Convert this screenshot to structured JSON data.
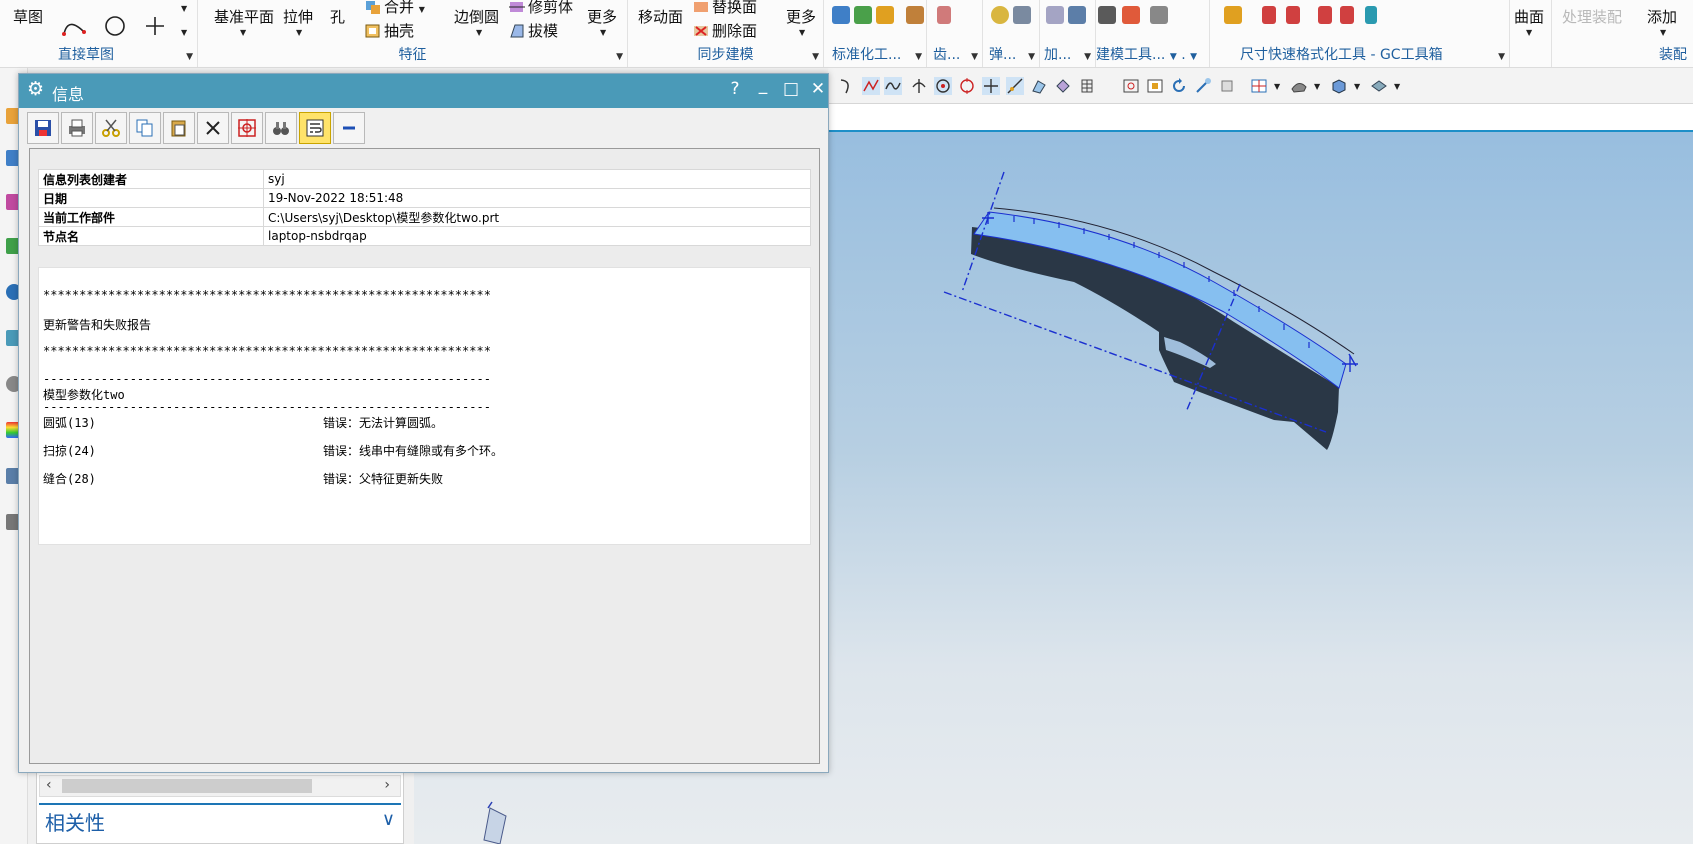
{
  "ribbon": {
    "sketch_label": "草图",
    "direct_sketch_group": "直接草图",
    "feature_group": "特征",
    "datum_plane": "基准平面",
    "extrude": "拉伸",
    "hole": "孔",
    "unite": "合并",
    "shell": "抽壳",
    "edge_blend": "边倒圆",
    "trim_body": "修剪体",
    "draft": "拔模",
    "more_label": "更多",
    "sync_group": "同步建模",
    "move_face": "移动面",
    "replace_face": "替换面",
    "delete_face": "删除面",
    "standard_parts": "标准化工...",
    "gear": "齿...",
    "spring": "弹...",
    "add": "加...",
    "modeling_tools": "建模工具...",
    "dot": ".",
    "gc_toolbox": "尺寸快速格式化工具 - GC工具箱",
    "surface": "曲面",
    "process_assembly": "处理装配",
    "add_label": "添加",
    "assembly_group": "装配"
  },
  "dialog": {
    "title": "信息",
    "help": "?",
    "minimize": "_",
    "maximize": "□",
    "close": "✕",
    "header_rows": [
      {
        "key": "信息列表创建者",
        "value": "syj"
      },
      {
        "key": "日期",
        "value": "19-Nov-2022 18:51:48"
      },
      {
        "key": "当前工作部件",
        "value": "C:\\Users\\syj\\Desktop\\模型参数化two.prt"
      },
      {
        "key": "节点名",
        "value": "laptop-nsbdrqap"
      }
    ],
    "report": {
      "stars1": "**************************************************************",
      "heading": "更新警告和失败报告",
      "stars2": "**************************************************************",
      "dashes1": "--------------------------------------------------------------",
      "model_name": "模型参数化two",
      "dashes2": "--------------------------------------------------------------",
      "rows": [
        {
          "feature": "圆弧(13)",
          "message": "错误：无法计算圆弧。"
        },
        {
          "feature": "扫掠(24)",
          "message": "错误：线串中有缝隙或有多个环。"
        },
        {
          "feature": "缝合(28)",
          "message": "错误：父特征更新失败"
        }
      ]
    }
  },
  "navigator": {
    "relations_title": "相关性"
  },
  "colors": {
    "titlebar": "#4a9ab8",
    "ribbon_group_label": "#1f5f9e",
    "model_dark": "#2a3746",
    "model_light": "#86bff0",
    "construction_line": "#1a2fd0"
  }
}
